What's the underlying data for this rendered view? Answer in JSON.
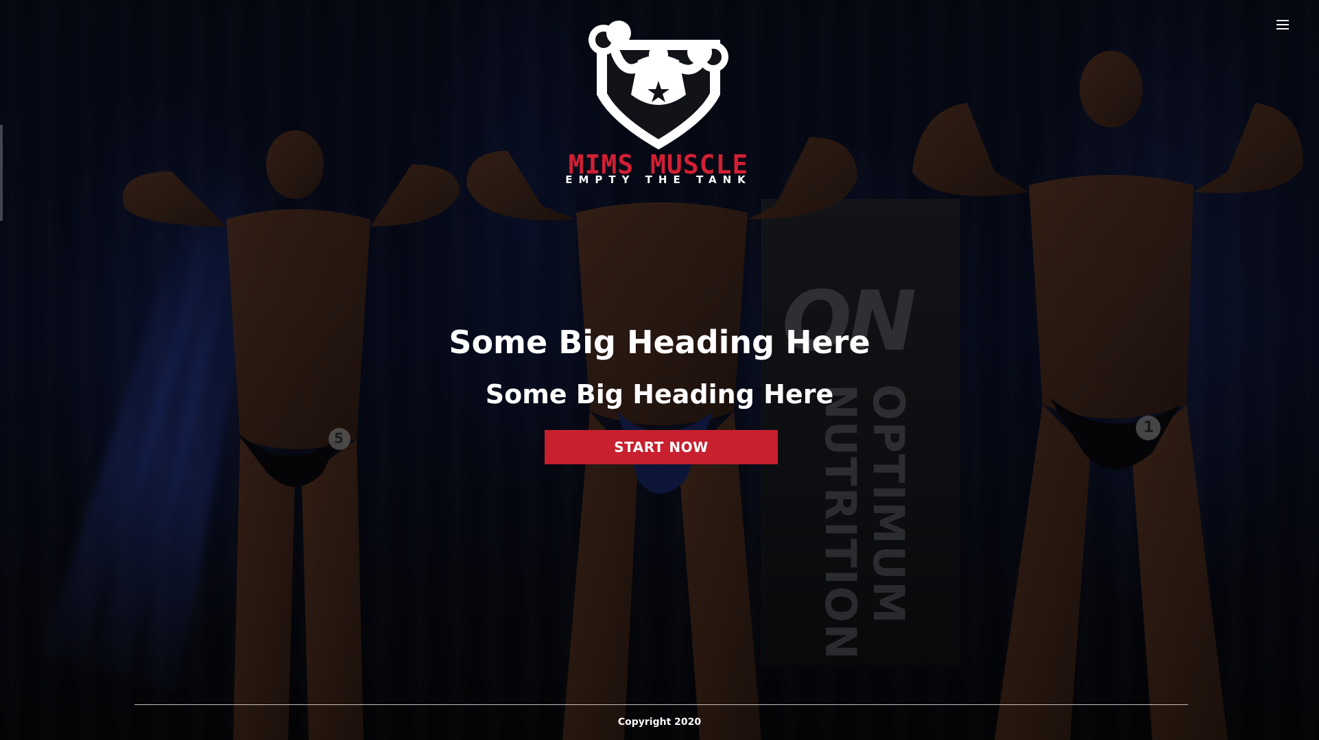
{
  "header": {
    "menu_icon": "hamburger-menu-icon"
  },
  "logo": {
    "icon": "bodybuilder-dumbbell-shield-logo",
    "brand_name": "MIMS MUSCLE",
    "tagline": "EMPTY THE TANK"
  },
  "background": {
    "banner_brand": "ON",
    "banner_text": "OPTIMUM NUTRITION",
    "athlete_numbers": [
      "5",
      "1"
    ]
  },
  "hero": {
    "heading_primary": "Some Big Heading Here",
    "heading_secondary": "Some Big Heading Here",
    "cta_label": "START NOW"
  },
  "footer": {
    "copyright": "Copyright 2020"
  },
  "colors": {
    "accent": "#c8202f",
    "brand_red": "#d21f34",
    "text": "#ffffff"
  }
}
